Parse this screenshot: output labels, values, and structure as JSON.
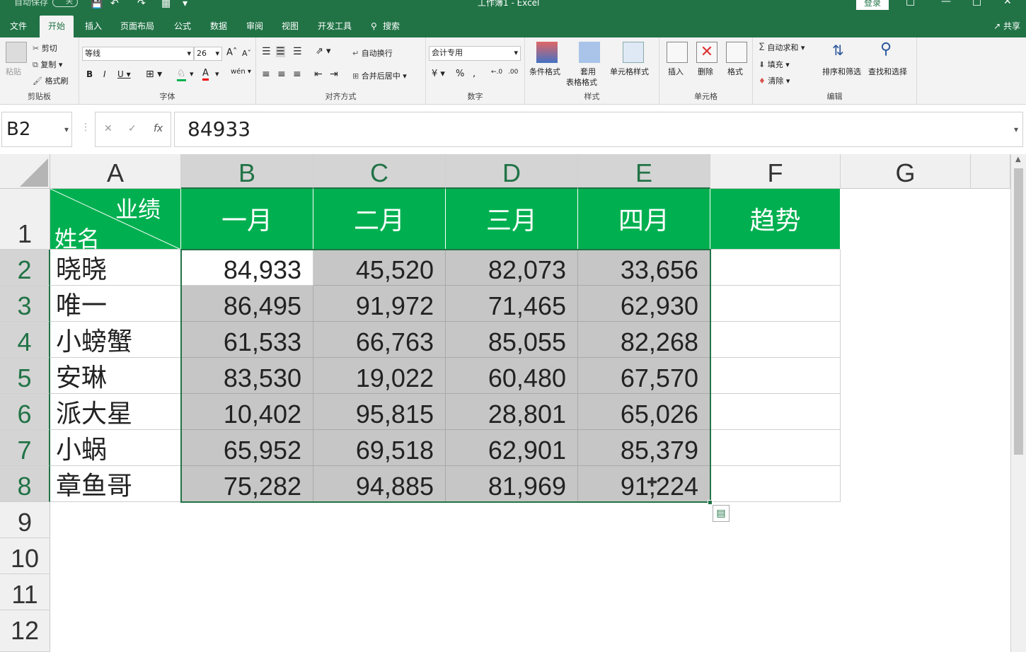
{
  "titlebar": {
    "autosave": "自动保存",
    "autosave_state": "关",
    "title": "工作簿1 - Excel",
    "login": "登录"
  },
  "tabs": [
    "文件",
    "开始",
    "插入",
    "页面布局",
    "公式",
    "数据",
    "审阅",
    "视图",
    "开发工具",
    "搜索"
  ],
  "active_tab": "开始",
  "share": "共享",
  "ribbon": {
    "clipboard": {
      "label": "剪贴板",
      "paste": "粘贴",
      "cut": "剪切",
      "copy": "复制",
      "format_painter": "格式刷"
    },
    "font": {
      "label": "字体",
      "name": "等线",
      "size": "26"
    },
    "alignment": {
      "label": "对齐方式",
      "wrap": "自动换行",
      "merge": "合并后居中"
    },
    "number": {
      "label": "数字",
      "format": "会计专用"
    },
    "styles": {
      "label": "样式",
      "conditional": "条件格式",
      "table_1": "套用",
      "table_2": "表格格式",
      "cell_styles": "单元格样式"
    },
    "cells": {
      "label": "单元格",
      "insert": "插入",
      "delete": "删除",
      "format": "格式"
    },
    "editing": {
      "label": "编辑",
      "autosum": "自动求和",
      "fill": "填充",
      "clear": "清除",
      "sort": "排序和筛选",
      "find": "查找和选择"
    }
  },
  "formula_bar": {
    "name_box": "B2",
    "value": "84933"
  },
  "columns": [
    "A",
    "B",
    "C",
    "D",
    "E",
    "F",
    "G"
  ],
  "rows": [
    "1",
    "2",
    "3",
    "4",
    "5",
    "6",
    "7",
    "8",
    "9",
    "10",
    "11",
    "12"
  ],
  "table": {
    "header_top": "业绩",
    "header_bottom": "姓名",
    "months": [
      "一月",
      "二月",
      "三月",
      "四月"
    ],
    "trend": "趋势",
    "data": [
      {
        "name": "晓晓",
        "values": [
          "84,933",
          "45,520",
          "82,073",
          "33,656"
        ]
      },
      {
        "name": "唯一",
        "values": [
          "86,495",
          "91,972",
          "71,465",
          "62,930"
        ]
      },
      {
        "name": "小螃蟹",
        "values": [
          "61,533",
          "66,763",
          "85,055",
          "82,268"
        ]
      },
      {
        "name": "安琳",
        "values": [
          "83,530",
          "19,022",
          "60,480",
          "67,570"
        ]
      },
      {
        "name": "派大星",
        "values": [
          "10,402",
          "95,815",
          "28,801",
          "65,026"
        ]
      },
      {
        "name": "小蜗",
        "values": [
          "65,952",
          "69,518",
          "62,901",
          "85,379"
        ]
      },
      {
        "name": "章鱼哥",
        "values": [
          "75,282",
          "94,885",
          "81,969",
          "91,224"
        ]
      }
    ]
  },
  "colors": {
    "excel_green": "#217346",
    "header_fill": "#00b050",
    "selection_fill": "#c6c6c6"
  }
}
